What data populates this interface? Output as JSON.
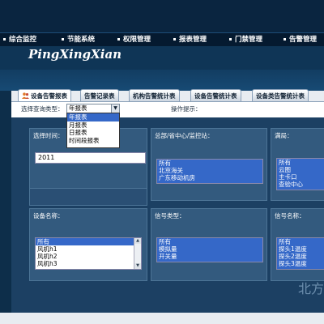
{
  "nav": {
    "items": [
      {
        "label": "综合监控"
      },
      {
        "label": "节能系统"
      },
      {
        "label": "权限管理"
      },
      {
        "label": "报表管理"
      },
      {
        "label": "门禁管理"
      },
      {
        "label": "告警管理"
      }
    ]
  },
  "brand": "PingXingXian",
  "tabs": [
    {
      "label": "设备告警报表",
      "active": true,
      "icon": "users-icon"
    },
    {
      "label": "告警记录表"
    },
    {
      "label": "机构告警统计表"
    },
    {
      "label": "设备告警统计表"
    },
    {
      "label": "设备类告警统计表"
    }
  ],
  "query": {
    "type_label": "选择查询类型：",
    "selected": "年报表",
    "options": [
      "年报表",
      "月报表",
      "日报表",
      "时间段报表"
    ],
    "hint_label": "操作提示："
  },
  "filters": {
    "time": {
      "label": "选择时间：",
      "value": "2011"
    },
    "org": {
      "label": "总部/省中心/监控站：",
      "items": [
        "所有",
        "北京海关",
        "广东移动机房"
      ]
    },
    "site": {
      "label": "满局：",
      "items": [
        "所有",
        "云图",
        "主卡口",
        "查验中心"
      ]
    },
    "device": {
      "label": "设备名称：",
      "items": [
        "所有",
        "风机h1",
        "风机h2",
        "风机h3"
      ]
    },
    "signal_type": {
      "label": "信号类型：",
      "items": [
        "所有",
        "模拟量",
        "开关量"
      ]
    },
    "signal_name": {
      "label": "信号名称：",
      "items": [
        "所有",
        "探头1温度",
        "探头2温度",
        "探头3温度"
      ]
    }
  },
  "watermark": "北方",
  "colors": {
    "accent": "#3568c8",
    "header": "#0a2540",
    "panel": "#1c4063"
  }
}
